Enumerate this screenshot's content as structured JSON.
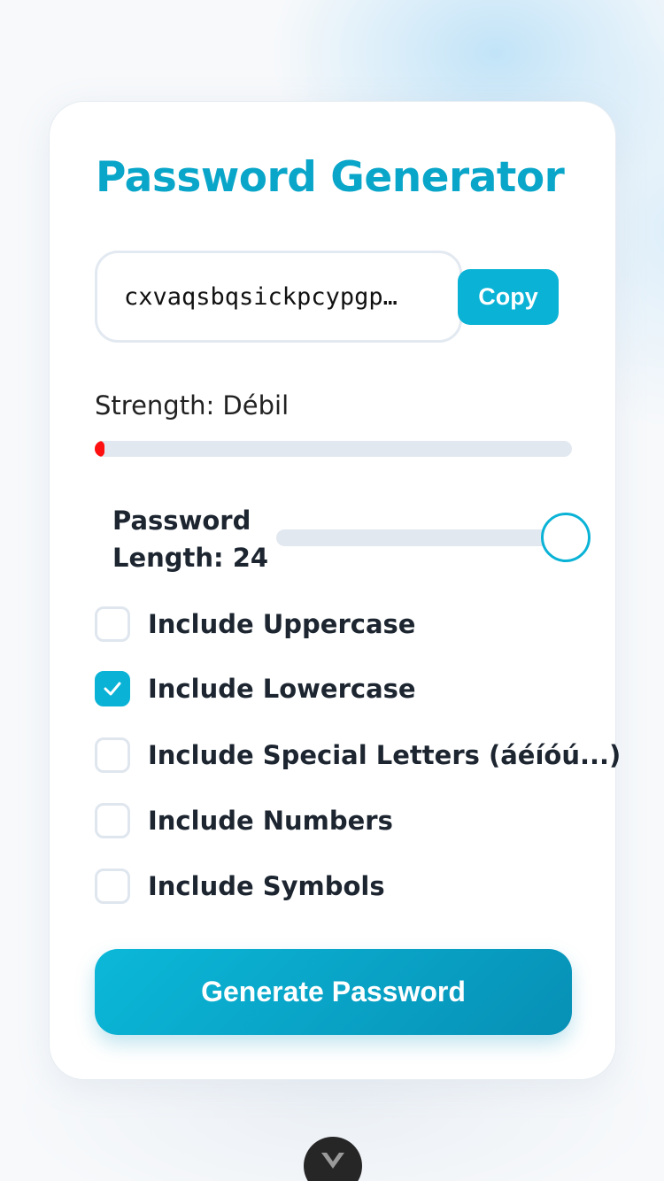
{
  "app": {
    "title": "Password Generator"
  },
  "password": {
    "value": "cxvaqsbqsickpcypgp…"
  },
  "copy_button": {
    "label": "Copy"
  },
  "strength": {
    "label": "Strength: Débil",
    "level": 0.02,
    "color": "#ff1010"
  },
  "length": {
    "label": "Password Length: 24",
    "value": 24,
    "slider_fraction": 1.0
  },
  "options": [
    {
      "label": "Include Uppercase",
      "checked": false
    },
    {
      "label": "Include Lowercase",
      "checked": true
    },
    {
      "label": "Include Special Letters (áéíóú...)",
      "checked": false
    },
    {
      "label": "Include Numbers",
      "checked": false
    },
    {
      "label": "Include Symbols",
      "checked": false
    }
  ],
  "generate_button": {
    "label": "Generate Password"
  },
  "colors": {
    "accent": "#0ab3d6",
    "title": "#0aa6c9"
  },
  "floating_button": {
    "icon": "chevron-down-icon"
  }
}
